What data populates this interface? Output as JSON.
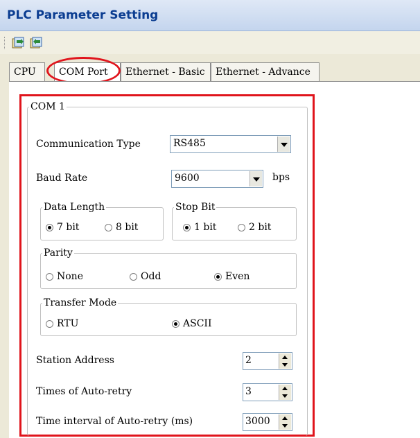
{
  "window": {
    "title": "PLC Parameter Setting"
  },
  "toolbar": {
    "buttons": [
      "import-icon",
      "export-icon"
    ]
  },
  "tabs": [
    {
      "label": "CPU",
      "active": false
    },
    {
      "label": "COM Port",
      "active": true
    },
    {
      "label": "Ethernet - Basic",
      "active": false
    },
    {
      "label": "Ethernet - Advance",
      "active": false
    }
  ],
  "com1": {
    "group_label": "COM 1",
    "comm_type": {
      "label": "Communication Type",
      "value": "RS485"
    },
    "baud": {
      "label": "Baud Rate",
      "value": "9600",
      "unit": "bps"
    },
    "data_length": {
      "label": "Data Length",
      "options": [
        "7 bit",
        "8 bit"
      ],
      "selected": "7 bit"
    },
    "stop_bit": {
      "label": "Stop Bit",
      "options": [
        "1 bit",
        "2 bit"
      ],
      "selected": "1 bit"
    },
    "parity": {
      "label": "Parity",
      "options": [
        "None",
        "Odd",
        "Even"
      ],
      "selected": "Even"
    },
    "transfer_mode": {
      "label": "Transfer Mode",
      "options": [
        "RTU",
        "ASCII"
      ],
      "selected": "ASCII"
    },
    "station_address": {
      "label": "Station Address",
      "value": "2"
    },
    "auto_retry": {
      "label": "Times of Auto-retry",
      "value": "3"
    },
    "retry_interval": {
      "label": "Time interval of Auto-retry (ms)",
      "value": "3000"
    }
  },
  "colors": {
    "highlight": "#e0141c",
    "title_text": "#0b3d91"
  }
}
